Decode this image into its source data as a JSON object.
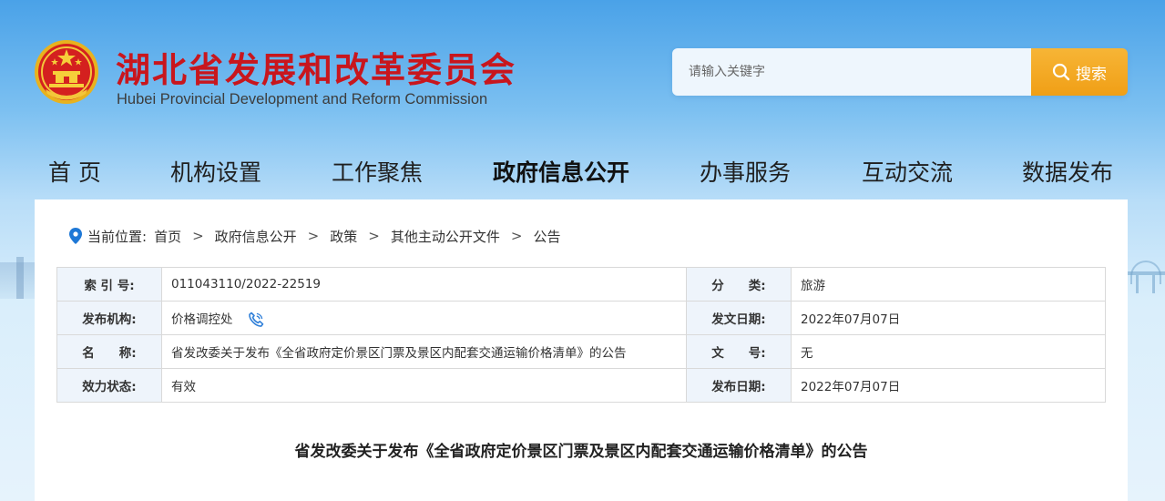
{
  "header": {
    "title": "湖北省发展和改革委员会",
    "subtitle": "Hubei Provincial Development and Reform Commission"
  },
  "search": {
    "placeholder": "请输入关键字",
    "button_label": "搜索"
  },
  "nav": {
    "items": [
      {
        "label": "首 页"
      },
      {
        "label": "机构设置"
      },
      {
        "label": "工作聚焦"
      },
      {
        "label": "政府信息公开"
      },
      {
        "label": "办事服务"
      },
      {
        "label": "互动交流"
      },
      {
        "label": "数据发布"
      }
    ],
    "active": "政府信息公开"
  },
  "breadcrumb": {
    "prefix": "当前位置:",
    "separator": ">",
    "items": [
      "首页",
      "政府信息公开",
      "政策",
      "其他主动公开文件",
      "公告"
    ]
  },
  "meta": {
    "rows": [
      {
        "k1": "索 引 号:",
        "v1": "011043110/2022-22519",
        "k2": "分　　类:",
        "v2": "旅游"
      },
      {
        "k1": "发布机构:",
        "v1": "价格调控处",
        "k2": "发文日期:",
        "v2": "2022年07月07日"
      },
      {
        "k1": "名　　称:",
        "v1": "省发改委关于发布《全省政府定价景区门票及景区内配套交通运输价格清单》的公告",
        "k2": "文　　号:",
        "v2": "无"
      },
      {
        "k1": "效力状态:",
        "v1": "有效",
        "k2": "发布日期:",
        "v2": "2022年07月07日"
      }
    ]
  },
  "article": {
    "title": "省发改委关于发布《全省政府定价景区门票及景区内配套交通运输价格清单》的公告"
  },
  "colors": {
    "title_red": "#c8161d",
    "search_orange": "#f09f16",
    "table_key_bg": "#eef4fb",
    "location_blue": "#1e78d6"
  }
}
